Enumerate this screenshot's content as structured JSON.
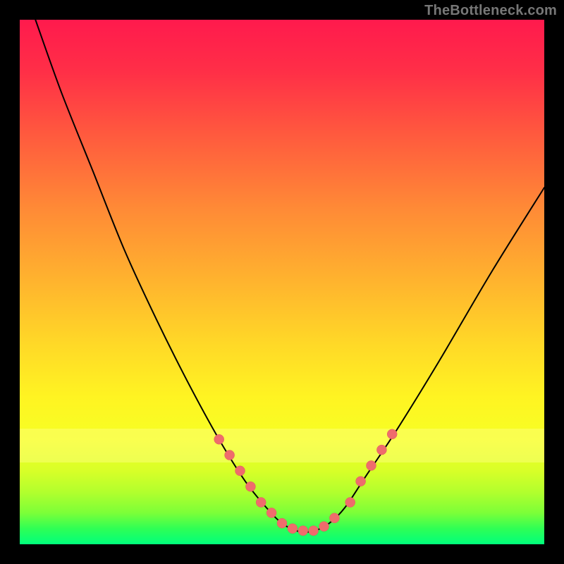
{
  "watermark": "TheBottleneck.com",
  "colors": {
    "frame_bg": "#000000",
    "curve": "#000000",
    "dot_fill": "#ef6c6c",
    "dot_stroke": "#e05a5a",
    "gradient_top": "#ff1a4d",
    "gradient_bottom": "#00ff7c"
  },
  "chart_data": {
    "type": "line",
    "title": "",
    "xlabel": "",
    "ylabel": "",
    "xlim": [
      0,
      100
    ],
    "ylim": [
      0,
      100
    ],
    "curve": [
      {
        "x": 3,
        "y": 100
      },
      {
        "x": 8,
        "y": 86
      },
      {
        "x": 14,
        "y": 71
      },
      {
        "x": 20,
        "y": 56
      },
      {
        "x": 26,
        "y": 43
      },
      {
        "x": 32,
        "y": 31
      },
      {
        "x": 38,
        "y": 20
      },
      {
        "x": 43,
        "y": 12
      },
      {
        "x": 47,
        "y": 7
      },
      {
        "x": 50,
        "y": 4
      },
      {
        "x": 53,
        "y": 2.5
      },
      {
        "x": 56,
        "y": 2.5
      },
      {
        "x": 59,
        "y": 4
      },
      {
        "x": 62,
        "y": 7
      },
      {
        "x": 66,
        "y": 13
      },
      {
        "x": 72,
        "y": 22
      },
      {
        "x": 80,
        "y": 35
      },
      {
        "x": 90,
        "y": 52
      },
      {
        "x": 100,
        "y": 68
      }
    ],
    "dots": [
      {
        "x": 38,
        "y": 20
      },
      {
        "x": 40,
        "y": 17
      },
      {
        "x": 42,
        "y": 14
      },
      {
        "x": 44,
        "y": 11
      },
      {
        "x": 46,
        "y": 8
      },
      {
        "x": 48,
        "y": 6
      },
      {
        "x": 50,
        "y": 4
      },
      {
        "x": 52,
        "y": 3
      },
      {
        "x": 54,
        "y": 2.6
      },
      {
        "x": 56,
        "y": 2.6
      },
      {
        "x": 58,
        "y": 3.4
      },
      {
        "x": 60,
        "y": 5
      },
      {
        "x": 63,
        "y": 8
      },
      {
        "x": 65,
        "y": 12
      },
      {
        "x": 67,
        "y": 15
      },
      {
        "x": 69,
        "y": 18
      },
      {
        "x": 71,
        "y": 21
      }
    ]
  }
}
